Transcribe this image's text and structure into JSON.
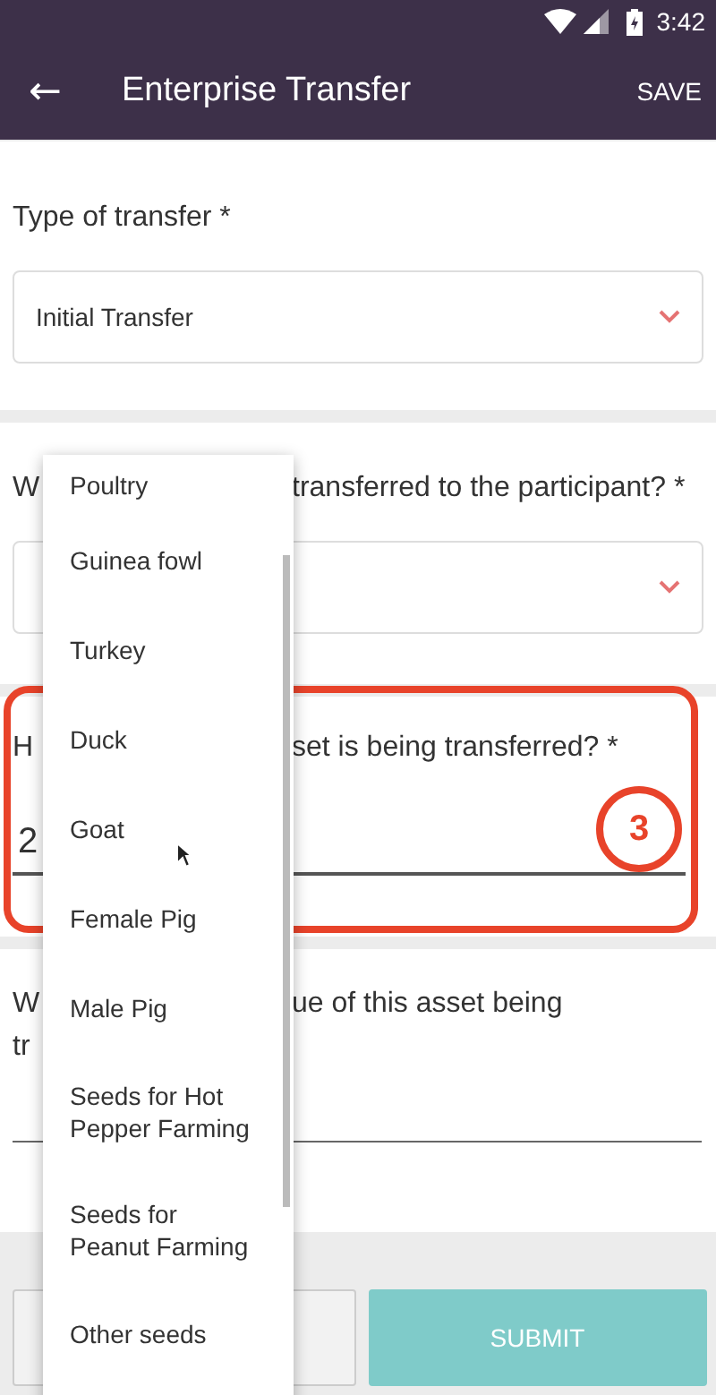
{
  "status_bar": {
    "time": "3:42"
  },
  "app_bar": {
    "back": "←",
    "title": "Enterprise Transfer",
    "action": "SAVE"
  },
  "questions": [
    {
      "kind": "select",
      "label_parts": [
        "Type of transfer *"
      ],
      "value": "Initial Transfer"
    },
    {
      "kind": "select",
      "label_parts": [
        "W",
        "transferred to the participant? *"
      ]
    },
    {
      "kind": "text",
      "label_parts": [
        "H",
        "set is being transferred? *"
      ],
      "value": "2"
    },
    {
      "kind": "text",
      "label_parts": [
        "W",
        "ue of this asset being",
        "tr"
      ]
    }
  ],
  "menu": {
    "items": [
      {
        "label": "Poultry"
      },
      {
        "label": "Guinea fowl"
      },
      {
        "label": "Turkey"
      },
      {
        "label": "Duck"
      },
      {
        "label": "Goat"
      },
      {
        "label": "Female Pig"
      },
      {
        "label": "Male Pig"
      },
      {
        "label": "Seeds for Hot Pepper Farming"
      },
      {
        "label": "Seeds for Peanut Farming"
      },
      {
        "label": "Other seeds"
      }
    ]
  },
  "buttons": [
    {
      "kind": "outline"
    },
    {
      "kind": "primary",
      "label": "SUBMIT"
    }
  ],
  "annotation": {
    "number": "3"
  }
}
